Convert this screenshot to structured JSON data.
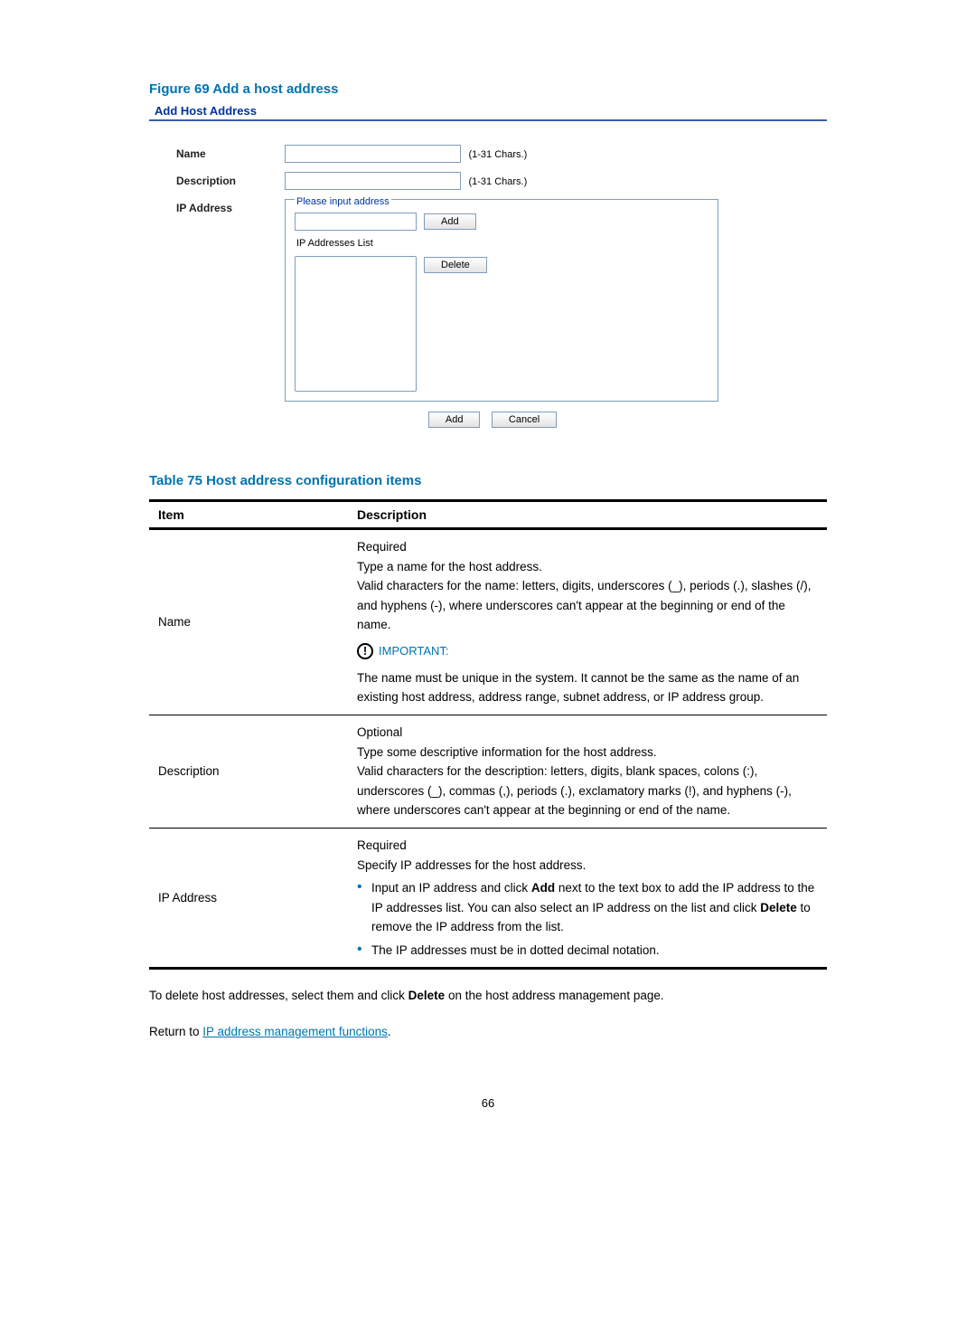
{
  "figure": {
    "caption": "Figure 69 Add a host address",
    "panel_title": "Add Host Address",
    "labels": {
      "name": "Name",
      "description": "Description",
      "ip_address": "IP Address"
    },
    "hints": {
      "name": "(1-31 Chars.)",
      "description": "(1-31 Chars.)"
    },
    "fieldset": {
      "legend_input": "Please input address",
      "legend_list": "IP Addresses List",
      "add_btn": "Add",
      "delete_btn": "Delete"
    },
    "bottom": {
      "add_btn": "Add",
      "cancel_btn": "Cancel"
    }
  },
  "table": {
    "caption": "Table 75 Host address configuration items",
    "headers": {
      "item": "Item",
      "description": "Description"
    },
    "rows": {
      "name": {
        "item": "Name",
        "p1": "Required",
        "p2": "Type a name for the host address.",
        "p3": "Valid characters for the name: letters, digits, underscores (_), periods (.), slashes (/), and hyphens (-), where underscores can't appear at the beginning or end of the name.",
        "important_label": "IMPORTANT:",
        "p4": "The name must be unique in the system. It cannot be the same as the name of an existing host address, address range, subnet address, or IP address group."
      },
      "description": {
        "item": "Description",
        "p1": "Optional",
        "p2": "Type some descriptive information for the host address.",
        "p3": "Valid characters for the description: letters, digits, blank spaces, colons (:), underscores (_), commas (,), periods (.), exclamatory marks (!), and hyphens (-), where underscores can't appear at the beginning or end of the name."
      },
      "ip": {
        "item": "IP Address",
        "p1": "Required",
        "p2": "Specify IP addresses for the host address.",
        "b1a": "Input an IP address and click ",
        "b1_bold1": "Add",
        "b1b": " next to the text box to add the IP address to the IP addresses list. You can also select an IP address on the list and click ",
        "b1_bold2": "Delete",
        "b1c": " to remove the IP address from the list.",
        "b2": "The IP addresses must be in dotted decimal notation."
      }
    }
  },
  "footer": {
    "p1a": "To delete host addresses, select them and click ",
    "p1_bold": "Delete",
    "p1b": " on the host address management page.",
    "p2a": "Return to ",
    "p2_link": "IP address management functions",
    "p2b": "."
  },
  "page_number": "66"
}
